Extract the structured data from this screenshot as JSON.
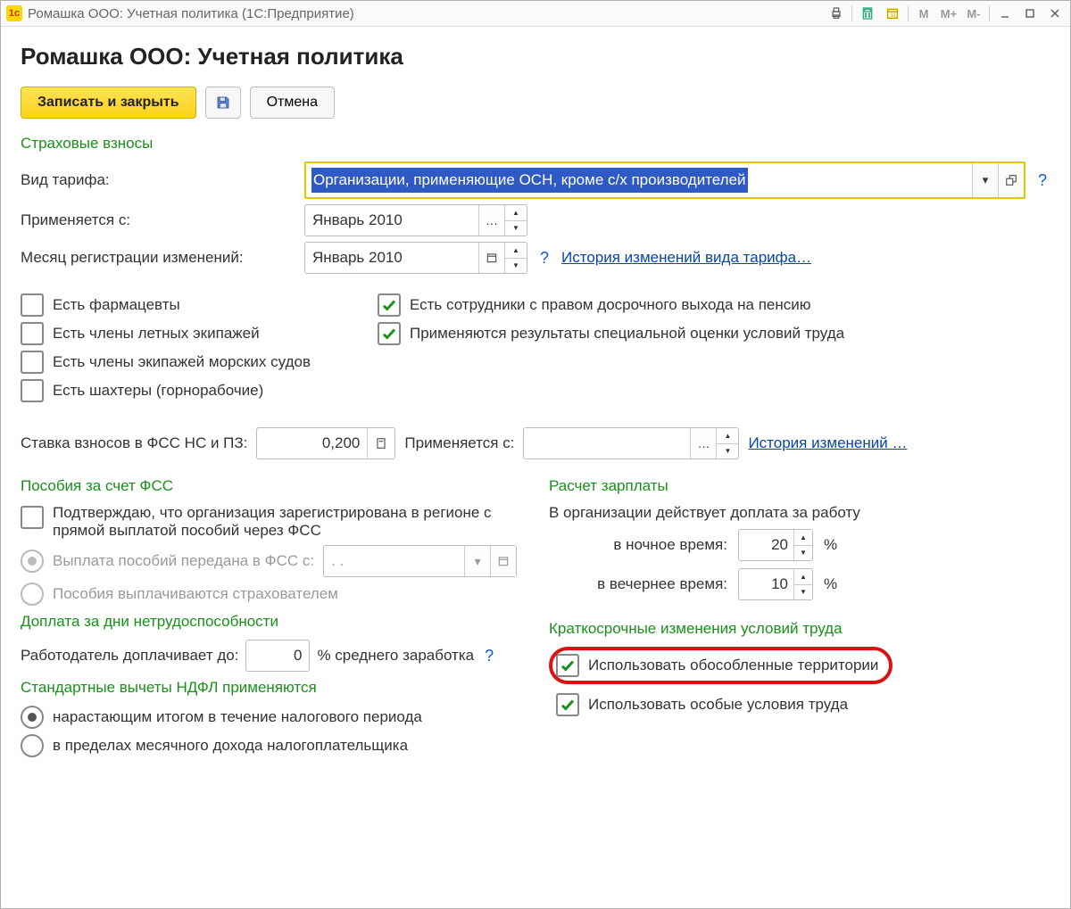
{
  "titlebar": {
    "title": "Ромашка ООО: Учетная политика  (1С:Предприятие)"
  },
  "header": {
    "page_title": "Ромашка ООО: Учетная политика"
  },
  "toolbar": {
    "save_close": "Записать и закрыть",
    "cancel": "Отмена"
  },
  "sections": {
    "insurance": "Страховые взносы",
    "fss_benefits": "Пособия за счет ФСС",
    "sick_pay": "Доплата за дни нетрудоспособности",
    "ndfl": "Стандартные вычеты НДФЛ применяются",
    "payroll": "Расчет зарплаты",
    "conditions": "Краткосрочные изменения условий труда"
  },
  "insurance": {
    "tariff_label": "Вид тарифа:",
    "tariff_value": "Организации, применяющие ОСН, кроме с/х производителей",
    "applied_from_label": "Применяется с:",
    "applied_from_value": "Январь 2010",
    "reg_month_label": "Месяц регистрации изменений:",
    "reg_month_value": "Январь 2010",
    "history_link": "История изменений вида тарифа…",
    "chk_pharma": "Есть фармацевты",
    "chk_flight": "Есть члены летных экипажей",
    "chk_sea": "Есть члены экипажей морских судов",
    "chk_miners": "Есть шахтеры (горнорабочие)",
    "chk_pension": "Есть сотрудники с правом досрочного выхода на пенсию",
    "chk_special": "Применяются результаты специальной оценки условий труда"
  },
  "fss_rate": {
    "label": "Ставка взносов в ФСС НС и ПЗ:",
    "value": "0,200",
    "applied_from_label": "Применяется с:",
    "applied_from_value": "",
    "history_link": "История изменений …"
  },
  "fss_benefits": {
    "confirm": "Подтверждаю, что организация зарегистрирована в регионе с прямой выплатой пособий через ФСС",
    "opt_fss": "Выплата пособий передана в ФСС с:",
    "opt_fss_date": ". .",
    "opt_insurer": "Пособия выплачиваются страхователем"
  },
  "sick_pay": {
    "label": "Работодатель доплачивает до:",
    "value": "0",
    "suffix": "% среднего заработка"
  },
  "ndfl": {
    "opt_accrued": "нарастающим итогом в течение налогового периода",
    "opt_monthly": "в пределах месячного дохода налогоплательщика"
  },
  "payroll": {
    "intro": "В организации действует доплата за работу",
    "night_label": "в ночное время:",
    "night_value": "20",
    "evening_label": "в вечернее время:",
    "evening_value": "10",
    "pct": "%"
  },
  "conditions": {
    "opt_territories": "Использовать обособленные территории",
    "opt_special": "Использовать особые условия труда"
  }
}
